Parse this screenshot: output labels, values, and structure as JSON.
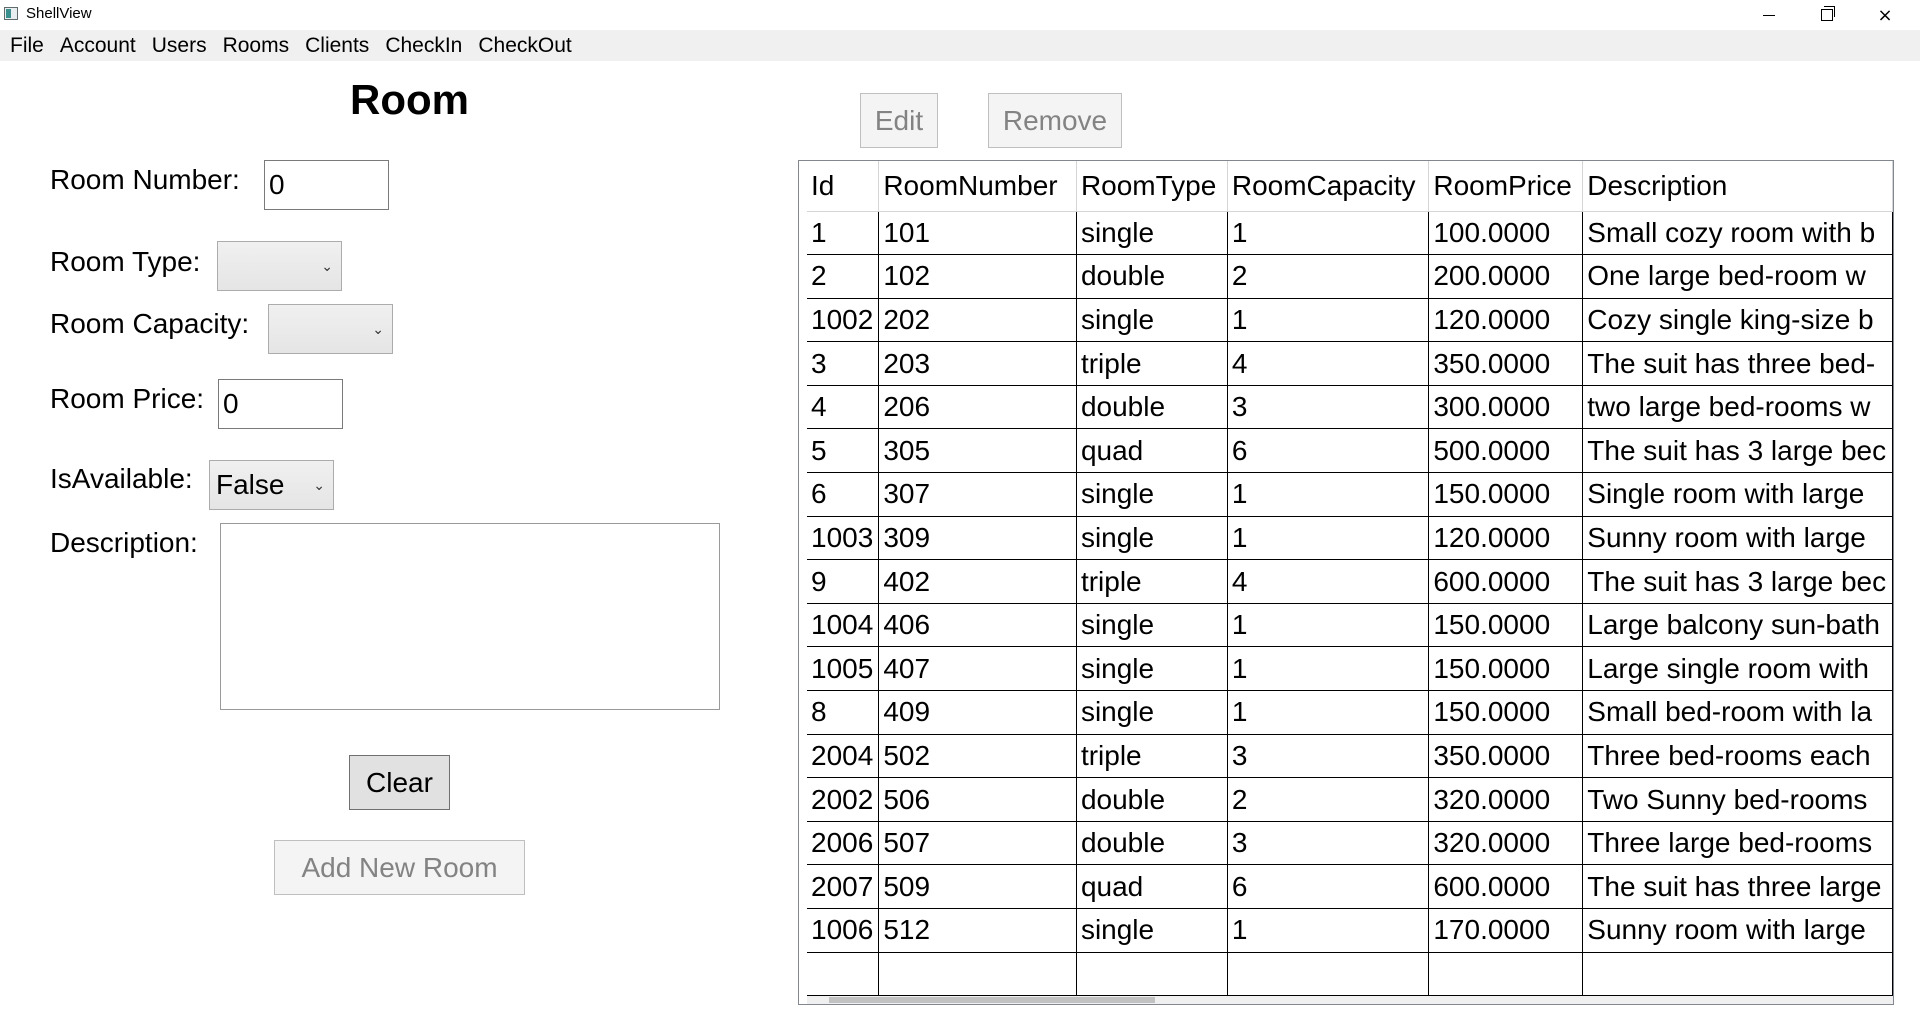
{
  "window": {
    "title": "ShellView",
    "minimize_glyph": "minimize-icon",
    "maximize_glyph": "restore-icon",
    "close_glyph": "×"
  },
  "menu": [
    "File",
    "Account",
    "Users",
    "Rooms",
    "Clients",
    "CheckIn",
    "CheckOut"
  ],
  "form": {
    "heading": "Room",
    "room_number_label": "Room Number:",
    "room_number_value": "0",
    "room_type_label": "Room Type:",
    "room_type_value": "",
    "room_capacity_label": "Room Capacity:",
    "room_capacity_value": "",
    "room_price_label": "Room Price:",
    "room_price_value": "0",
    "is_available_label": "IsAvailable:",
    "is_available_value": "False",
    "description_label": "Description:",
    "description_value": "",
    "clear_button": "Clear",
    "add_button": "Add New Room"
  },
  "toolbar": {
    "edit_button": "Edit",
    "remove_button": "Remove"
  },
  "grid": {
    "columns": [
      "Id",
      "RoomNumber",
      "RoomType",
      "RoomCapacity",
      "RoomPrice",
      "Description"
    ],
    "rows": [
      [
        "1",
        "101",
        "single",
        "1",
        "100.0000",
        "Small cozy room with b"
      ],
      [
        "2",
        "102",
        "double",
        "2",
        "200.0000",
        "One large bed-room w"
      ],
      [
        "1002",
        "202",
        "single",
        "1",
        "120.0000",
        "Cozy single king-size b"
      ],
      [
        "3",
        "203",
        "triple",
        "4",
        "350.0000",
        "The suit has three bed-"
      ],
      [
        "4",
        "206",
        "double",
        "3",
        "300.0000",
        "two large bed-rooms w"
      ],
      [
        "5",
        "305",
        "quad",
        "6",
        "500.0000",
        "The suit has 3 large bec"
      ],
      [
        "6",
        "307",
        "single",
        "1",
        "150.0000",
        "Single room with large"
      ],
      [
        "1003",
        "309",
        "single",
        "1",
        "120.0000",
        "Sunny room with large"
      ],
      [
        "9",
        "402",
        "triple",
        "4",
        "600.0000",
        "The suit has 3 large bec"
      ],
      [
        "1004",
        "406",
        "single",
        "1",
        "150.0000",
        "Large balcony sun-bath"
      ],
      [
        "1005",
        "407",
        "single",
        "1",
        "150.0000",
        "Large single room with"
      ],
      [
        "8",
        "409",
        "single",
        "1",
        "150.0000",
        "Small bed-room with la"
      ],
      [
        "2004",
        "502",
        "triple",
        "3",
        "350.0000",
        "Three bed-rooms each"
      ],
      [
        "2002",
        "506",
        "double",
        "2",
        "320.0000",
        "Two Sunny bed-rooms"
      ],
      [
        "2006",
        "507",
        "double",
        "3",
        "320.0000",
        "Three large bed-rooms"
      ],
      [
        "2007",
        "509",
        "quad",
        "6",
        "600.0000",
        "The suit has three large"
      ],
      [
        "1006",
        "512",
        "single",
        "1",
        "170.0000",
        "Sunny room with large"
      ]
    ]
  }
}
